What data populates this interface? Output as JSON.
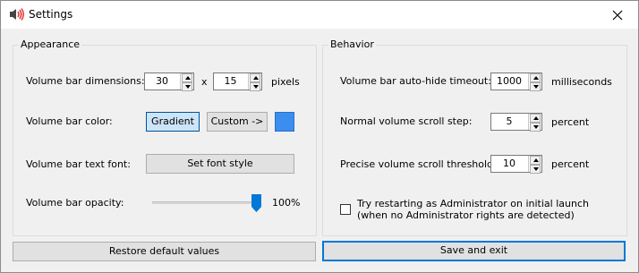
{
  "window": {
    "title": "Settings",
    "accent_color": "#0078d7"
  },
  "appearance": {
    "group_label": "Appearance",
    "dimensions_label": "Volume bar dimensions:",
    "width_value": "30",
    "times_symbol": "x",
    "height_value": "15",
    "pixels_unit": "pixels",
    "color_label": "Volume bar color:",
    "gradient_button": "Gradient",
    "custom_button": "Custom ->",
    "custom_color": "#3a8ef0",
    "font_label": "Volume bar text font:",
    "font_button": "Set font style",
    "opacity_label": "Volume bar opacity:",
    "opacity_value_text": "100%",
    "opacity_level": 1.0
  },
  "behavior": {
    "group_label": "Behavior",
    "autohide_label": "Volume bar auto-hide timeout:",
    "autohide_value": "1000",
    "autohide_unit": "milliseconds",
    "scroll_step_label": "Normal volume scroll step:",
    "scroll_step_value": "5",
    "scroll_step_unit": "percent",
    "precise_label": "Precise volume scroll threshold:",
    "precise_value": "10",
    "precise_unit": "percent",
    "admin_checkbox_line1": "Try restarting as Administrator on initial launch",
    "admin_checkbox_line2": "(when no Administrator rights are detected)",
    "admin_checked": false
  },
  "footer": {
    "restore_button": "Restore default values",
    "save_button": "Save and exit"
  },
  "icons": {
    "app": "speaker-icon",
    "close": "close-icon"
  }
}
